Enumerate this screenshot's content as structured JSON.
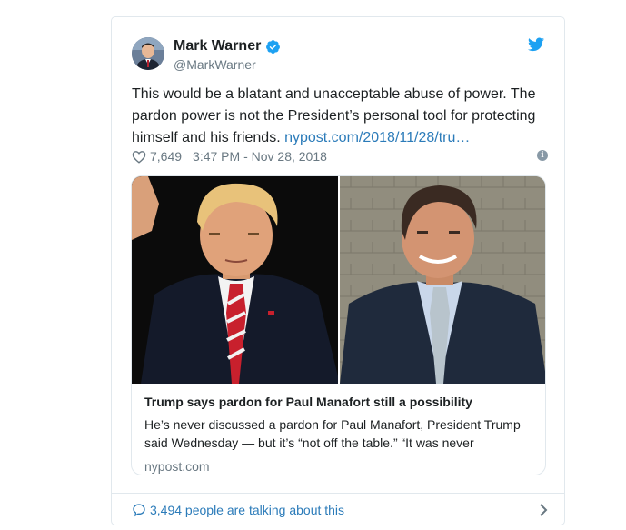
{
  "author": {
    "name": "Mark Warner",
    "handle": "@MarkWarner"
  },
  "tweet": {
    "text": "This would be a blatant and unacceptable abuse of power. The pardon power is not the President’s personal tool for protecting himself and his friends.",
    "link": "nypost.com/2018/11/28/tru…",
    "likes": "7,649",
    "timestamp": "3:47 PM - Nov 28, 2018"
  },
  "card": {
    "title": "Trump says pardon for Paul Manafort still a possibility",
    "description": "He’s never discussed a pardon for Paul Manafort, President Trump said Wednesday — but it’s “not off the table.” “It was never",
    "domain": "nypost.com"
  },
  "footer": {
    "talking": "3,494 people are talking about this"
  },
  "icons": {
    "verified": "verified-badge-icon",
    "bird": "twitter-bird-icon",
    "heart": "heart-icon",
    "info": "info-icon",
    "bubble": "speech-bubble-icon",
    "chevron": "chevron-right-icon"
  },
  "colors": {
    "link": "#2b7bb9",
    "twitter_blue": "#1da1f2",
    "muted": "#697882"
  }
}
